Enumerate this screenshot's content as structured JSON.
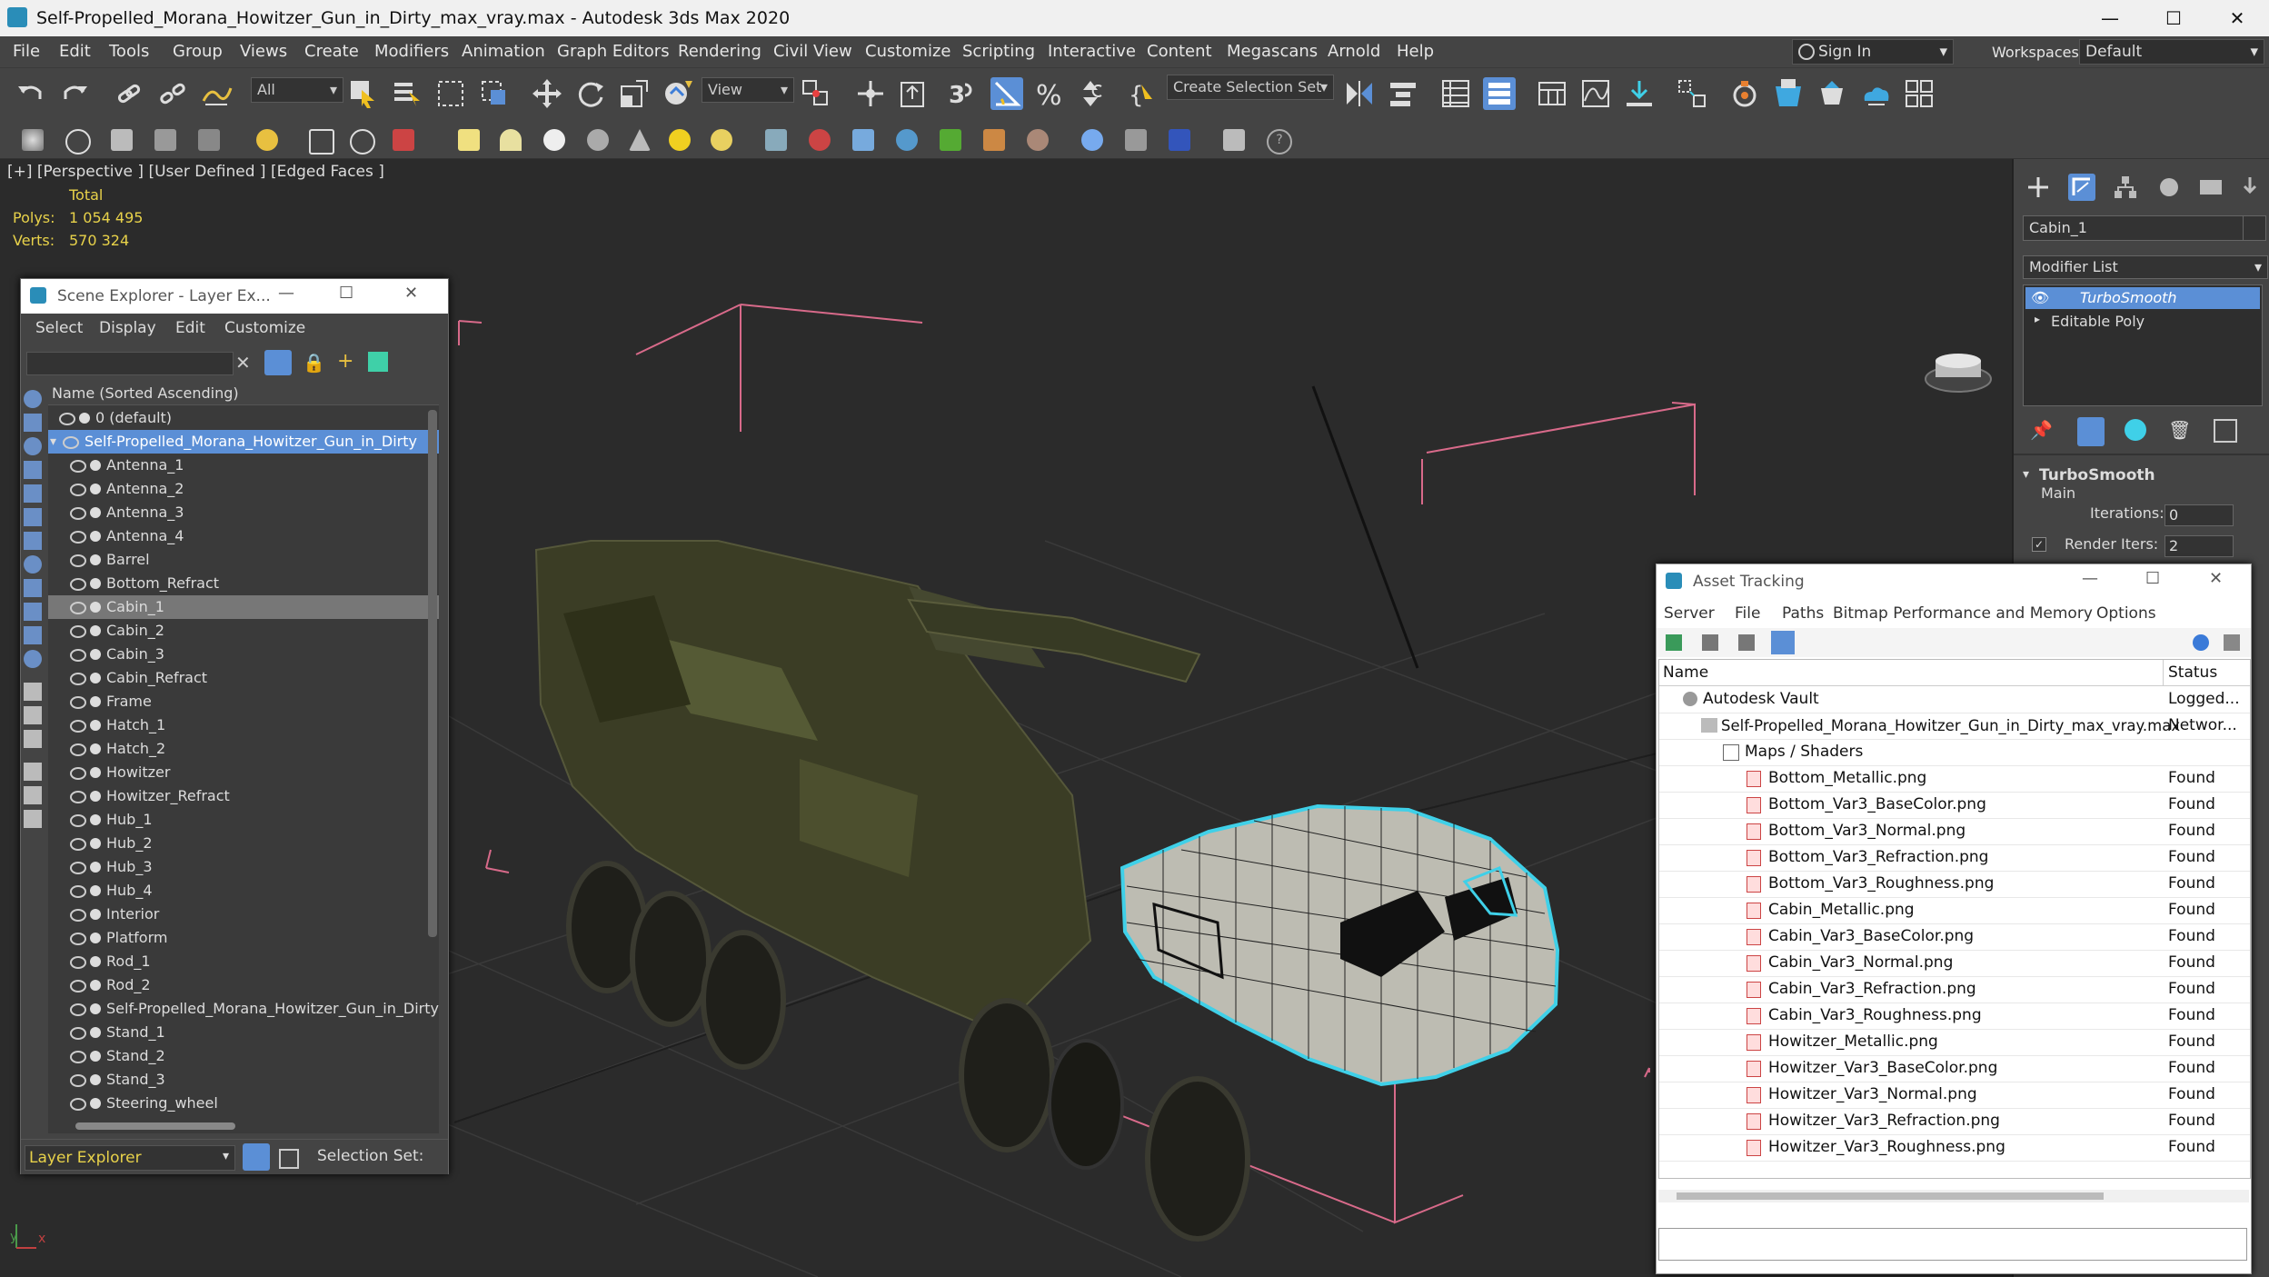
{
  "window": {
    "title": "Self-Propelled_Morana_Howitzer_Gun_in_Dirty_max_vray.max - Autodesk 3ds Max 2020",
    "min": "—",
    "max": "☐",
    "close": "✕"
  },
  "menubar": {
    "items": [
      "File",
      "Edit",
      "Tools",
      "Group",
      "Views",
      "Create",
      "Modifiers",
      "Animation",
      "Graph Editors",
      "Rendering",
      "Civil View",
      "Customize",
      "Scripting",
      "Interactive",
      "Content",
      "Megascans",
      "Arnold",
      "Help"
    ],
    "sign_in": "Sign In",
    "workspaces_label": "Workspaces:",
    "workspace_value": "Default"
  },
  "toolbar": {
    "filter_value": "All",
    "ref_coord": "View",
    "selection_set_placeholder": "Create Selection Set"
  },
  "viewport": {
    "label": "[+] [Perspective ] [User Defined ] [Edged Faces ]",
    "stats_total": "Total",
    "polys_label": "Polys:",
    "polys_value": "1 054 495",
    "verts_label": "Verts:",
    "verts_value": "570 324",
    "axis_x": "x",
    "axis_y": "y"
  },
  "command_panel": {
    "object_name": "Cabin_1",
    "modifier_list_label": "Modifier List",
    "stack": [
      "TurboSmooth",
      "Editable Poly"
    ],
    "rollout_title": "TurboSmooth",
    "section_main": "Main",
    "iterations_label": "Iterations:",
    "iterations_value": "0",
    "render_iters_label": "Render Iters:",
    "render_iters_value": "2"
  },
  "scene_explorer": {
    "title": "Scene Explorer - Layer Ex...",
    "menu": [
      "Select",
      "Display",
      "Edit",
      "Customize"
    ],
    "column_header": "Name (Sorted Ascending)",
    "layer_default": "0 (default)",
    "root": "Self-Propelled_Morana_Howitzer_Gun_in_Dirty",
    "items": [
      "Antenna_1",
      "Antenna_2",
      "Antenna_3",
      "Antenna_4",
      "Barrel",
      "Bottom_Refract",
      "Cabin_1",
      "Cabin_2",
      "Cabin_3",
      "Cabin_Refract",
      "Frame",
      "Hatch_1",
      "Hatch_2",
      "Howitzer",
      "Howitzer_Refract",
      "Hub_1",
      "Hub_2",
      "Hub_3",
      "Hub_4",
      "Interior",
      "Platform",
      "Rod_1",
      "Rod_2",
      "Self-Propelled_Morana_Howitzer_Gun_in_Dirty",
      "Stand_1",
      "Stand_2",
      "Stand_3",
      "Steering_wheel"
    ],
    "selected_item": "Cabin_1",
    "footer_explorer": "Layer Explorer",
    "footer_selection": "Selection Set:"
  },
  "asset_tracking": {
    "title": "Asset Tracking",
    "menu": [
      "Server",
      "File",
      "Paths",
      "Bitmap Performance and Memory",
      "Options"
    ],
    "col_name": "Name",
    "col_status": "Status",
    "vault": {
      "name": "Autodesk Vault",
      "status": "Logged..."
    },
    "file": {
      "name": "Self-Propelled_Morana_Howitzer_Gun_in_Dirty_max_vray.max",
      "status": "Networ..."
    },
    "folder": "Maps / Shaders",
    "maps": [
      {
        "name": "Bottom_Metallic.png",
        "status": "Found"
      },
      {
        "name": "Bottom_Var3_BaseColor.png",
        "status": "Found"
      },
      {
        "name": "Bottom_Var3_Normal.png",
        "status": "Found"
      },
      {
        "name": "Bottom_Var3_Refraction.png",
        "status": "Found"
      },
      {
        "name": "Bottom_Var3_Roughness.png",
        "status": "Found"
      },
      {
        "name": "Cabin_Metallic.png",
        "status": "Found"
      },
      {
        "name": "Cabin_Var3_BaseColor.png",
        "status": "Found"
      },
      {
        "name": "Cabin_Var3_Normal.png",
        "status": "Found"
      },
      {
        "name": "Cabin_Var3_Refraction.png",
        "status": "Found"
      },
      {
        "name": "Cabin_Var3_Roughness.png",
        "status": "Found"
      },
      {
        "name": "Howitzer_Metallic.png",
        "status": "Found"
      },
      {
        "name": "Howitzer_Var3_BaseColor.png",
        "status": "Found"
      },
      {
        "name": "Howitzer_Var3_Normal.png",
        "status": "Found"
      },
      {
        "name": "Howitzer_Var3_Refraction.png",
        "status": "Found"
      },
      {
        "name": "Howitzer_Var3_Roughness.png",
        "status": "Found"
      }
    ]
  },
  "colors": {
    "accent_blue": "#5b8fd6",
    "selection_cyan": "#3fd0e8",
    "bbox_pink": "#d86a8a",
    "stats_yellow": "#e8d24a"
  }
}
